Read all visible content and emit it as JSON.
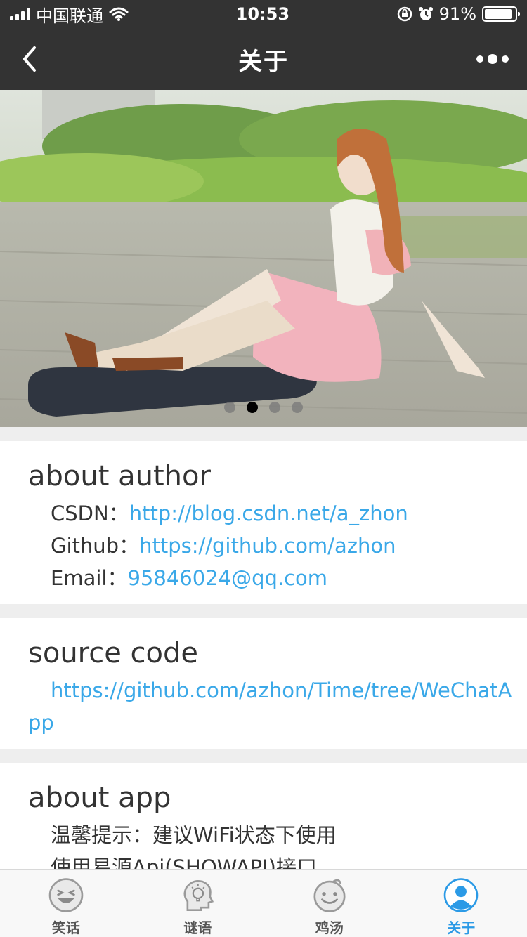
{
  "status_bar": {
    "carrier": "中国联通",
    "time": "10:53",
    "battery": "91%",
    "battery_level": 0.91
  },
  "nav": {
    "title": "关于",
    "back_icon": "chevron-left-icon",
    "more_icon": "more-dots-icon"
  },
  "banner": {
    "slide_count": 4,
    "active_index": 1
  },
  "about_author": {
    "title": "about author",
    "csdn_label": "CSDN：",
    "csdn_url": "http://blog.csdn.net/a_zhon",
    "github_label": "Github：",
    "github_url": "https://github.com/azhon",
    "email_label": "Email：",
    "email_value": "95846024@qq.com"
  },
  "source_code": {
    "title": "source code",
    "url": "https://github.com/azhon/Time/tree/WeChatApp"
  },
  "about_app": {
    "title": "about app",
    "line1": "温馨提示：建议WiFi状态下使用",
    "line2": "使用易源Api(SHOWAPI)接口"
  },
  "tabs": [
    {
      "label": "笑话",
      "icon": "laughing-face-icon",
      "active": false
    },
    {
      "label": "谜语",
      "icon": "thinking-head-icon",
      "active": false
    },
    {
      "label": "鸡汤",
      "icon": "smiling-face-icon",
      "active": false
    },
    {
      "label": "关于",
      "icon": "user-profile-icon",
      "active": true
    }
  ],
  "colors": {
    "bar_bg": "#333333",
    "link": "#3aa8e8",
    "tab_active": "#2b9ae6"
  }
}
